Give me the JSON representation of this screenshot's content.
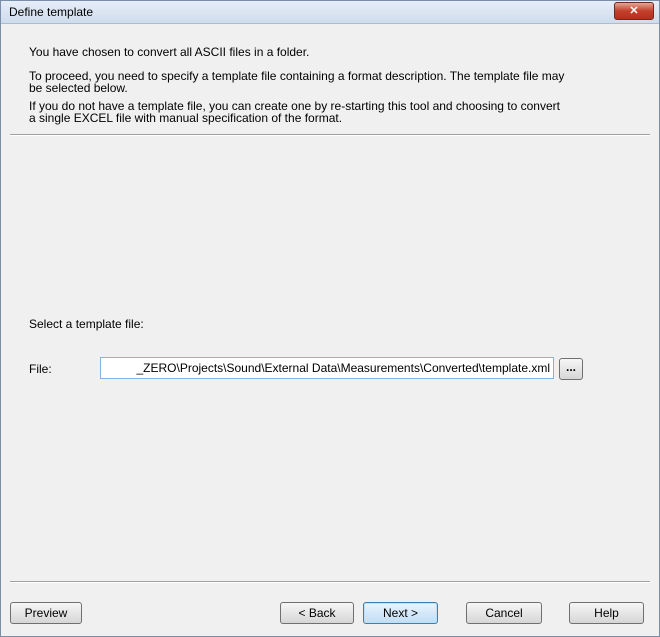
{
  "window": {
    "title": "Define template",
    "close_glyph": "✕"
  },
  "intro": {
    "line1": "You have chosen to convert all ASCII files in a folder.",
    "line2a": "To proceed, you need to specify a template file containing a format description. The template file may",
    "line2b": "be selected below.",
    "line3a": "If you do not have a template file, you can create one by re-starting this tool and choosing to convert",
    "line3b": "a single EXCEL file with manual specification of the format."
  },
  "template": {
    "select_label": "Select a template file:",
    "file_label": "File:",
    "file_value": "_ZERO\\Projects\\Sound\\External Data\\Measurements\\Converted\\template.xml",
    "browse_label": "..."
  },
  "buttons": {
    "preview": "Preview",
    "back": "< Back",
    "next": "Next >",
    "cancel": "Cancel",
    "help": "Help"
  }
}
